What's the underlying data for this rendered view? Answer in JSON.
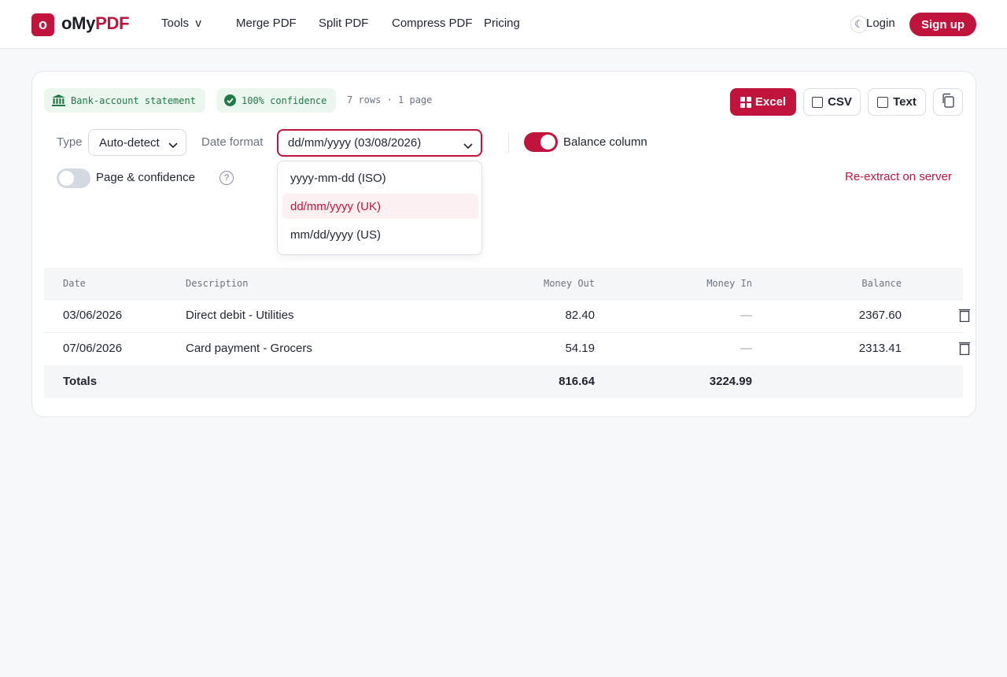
{
  "brand": {
    "logo_letter": "o",
    "name_part1": "oMy",
    "name_part2": "PDF",
    "accent_color": "#c0143c"
  },
  "nav": {
    "tools": "Tools",
    "tools_caret": "v",
    "merge": "Merge PDF",
    "split": "Split PDF",
    "compress": "Compress PDF",
    "pricing": "Pricing"
  },
  "header_right": {
    "theme_icon": "moon-icon",
    "login": "Login",
    "signup": "Sign up"
  },
  "statement": {
    "doc_type_chip": "Bank-account statement",
    "confidence_chip": "100% confidence",
    "rows_info": "7 rows · 1 page"
  },
  "export": {
    "excel": "Excel",
    "csv": "CSV",
    "text": "Text",
    "copy_icon": "copy-icon"
  },
  "controls": {
    "type_label": "Type",
    "type_value": "Auto-detect",
    "date_format_label": "Date format",
    "date_format_value": "dd/mm/yyyy (03/08/2026)",
    "balance_column_label": "Balance column",
    "balance_column_on": true,
    "page_confidence_label": "Page & confidence",
    "page_confidence_on": false,
    "help_glyph": "?",
    "reextract": "Re-extract on server"
  },
  "date_format_options": [
    {
      "label": "yyyy-mm-dd (ISO)",
      "selected": false
    },
    {
      "label": "dd/mm/yyyy (UK)",
      "selected": true
    },
    {
      "label": "mm/dd/yyyy (US)",
      "selected": false
    }
  ],
  "table": {
    "columns": [
      "Date",
      "Description",
      "Money Out",
      "Money In",
      "Balance"
    ],
    "rows": [
      {
        "date": "03/06/2026",
        "description": "Direct debit - Utilities",
        "money_out": "82.40",
        "money_in": "—",
        "balance": "2367.60"
      },
      {
        "date": "07/06/2026",
        "description": "Card payment - Grocers",
        "money_out": "54.19",
        "money_in": "—",
        "balance": "2313.41"
      }
    ],
    "totals": {
      "label": "Totals",
      "money_out": "816.64",
      "money_in": "3224.99"
    }
  }
}
